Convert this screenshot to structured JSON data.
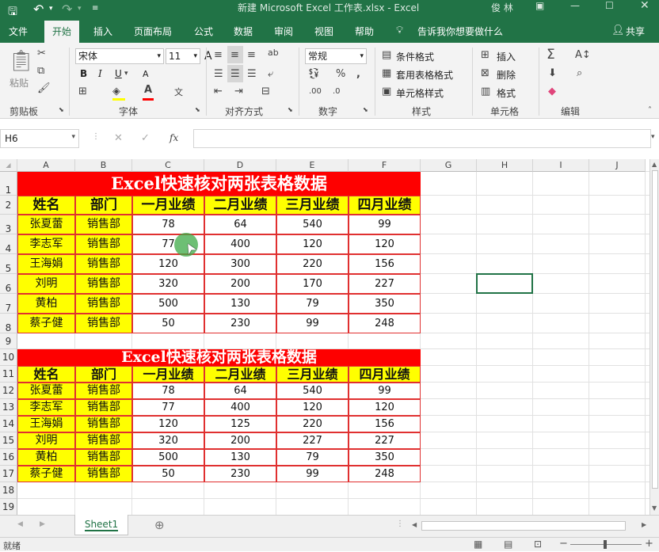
{
  "window": {
    "title": "新建 Microsoft Excel 工作表.xlsx  -  Excel",
    "user": "俊 林"
  },
  "menu": {
    "file": "文件",
    "home": "开始",
    "insert": "插入",
    "layout": "页面布局",
    "formulas": "公式",
    "data": "数据",
    "review": "审阅",
    "view": "视图",
    "help": "帮助",
    "tell_me": "告诉我你想要做什么",
    "share": "共享"
  },
  "ribbon": {
    "clipboard": {
      "label": "剪贴板",
      "paste": "粘贴"
    },
    "font": {
      "label": "字体",
      "font_name": "宋体",
      "font_size": "11",
      "bold": "B",
      "italic": "I",
      "underline": "U",
      "grow": "A",
      "shrink": "A"
    },
    "alignment": {
      "label": "对齐方式"
    },
    "number": {
      "label": "数字",
      "format": "常规"
    },
    "styles": {
      "label": "样式",
      "conditional": "条件格式",
      "table": "套用表格格式",
      "cell_styles": "单元格样式"
    },
    "cells": {
      "label": "单元格",
      "insert": "插入",
      "delete": "删除",
      "format": "格式"
    },
    "editing": {
      "label": "编辑"
    }
  },
  "formula_bar": {
    "name_box": "H6",
    "fx": "fx",
    "content": ""
  },
  "columns": [
    "A",
    "B",
    "C",
    "D",
    "E",
    "F",
    "G",
    "H",
    "I",
    "J"
  ],
  "rows": [
    "1",
    "2",
    "3",
    "4",
    "5",
    "6",
    "7",
    "8",
    "9",
    "10",
    "11",
    "12",
    "13",
    "14",
    "15",
    "16",
    "17",
    "18",
    "19"
  ],
  "table1": {
    "title": "Excel快速核对两张表格数据",
    "headers": [
      "姓名",
      "部门",
      "一月业绩",
      "二月业绩",
      "三月业绩",
      "四月业绩"
    ],
    "rows": [
      [
        "张夏蕾",
        "销售部",
        "78",
        "64",
        "540",
        "99"
      ],
      [
        "李志军",
        "销售部",
        "77",
        "400",
        "120",
        "120"
      ],
      [
        "王海娟",
        "销售部",
        "120",
        "300",
        "220",
        "156"
      ],
      [
        "刘明",
        "销售部",
        "320",
        "200",
        "170",
        "227"
      ],
      [
        "黄柏",
        "销售部",
        "500",
        "130",
        "79",
        "350"
      ],
      [
        "蔡子健",
        "销售部",
        "50",
        "230",
        "99",
        "248"
      ]
    ]
  },
  "table2": {
    "title": "Excel快速核对两张表格数据",
    "headers": [
      "姓名",
      "部门",
      "一月业绩",
      "二月业绩",
      "三月业绩",
      "四月业绩"
    ],
    "rows": [
      [
        "张夏蕾",
        "销售部",
        "78",
        "64",
        "540",
        "99"
      ],
      [
        "李志军",
        "销售部",
        "77",
        "400",
        "120",
        "120"
      ],
      [
        "王海娟",
        "销售部",
        "120",
        "125",
        "220",
        "156"
      ],
      [
        "刘明",
        "销售部",
        "320",
        "200",
        "227",
        "227"
      ],
      [
        "黄柏",
        "销售部",
        "500",
        "130",
        "79",
        "350"
      ],
      [
        "蔡子健",
        "销售部",
        "50",
        "230",
        "99",
        "248"
      ]
    ]
  },
  "sheet_tab": "Sheet1",
  "status": "就绪",
  "colors": {
    "accent": "#217346",
    "title_red": "#fe0000",
    "header_yellow": "#ffff00",
    "border_red": "#e03030"
  }
}
